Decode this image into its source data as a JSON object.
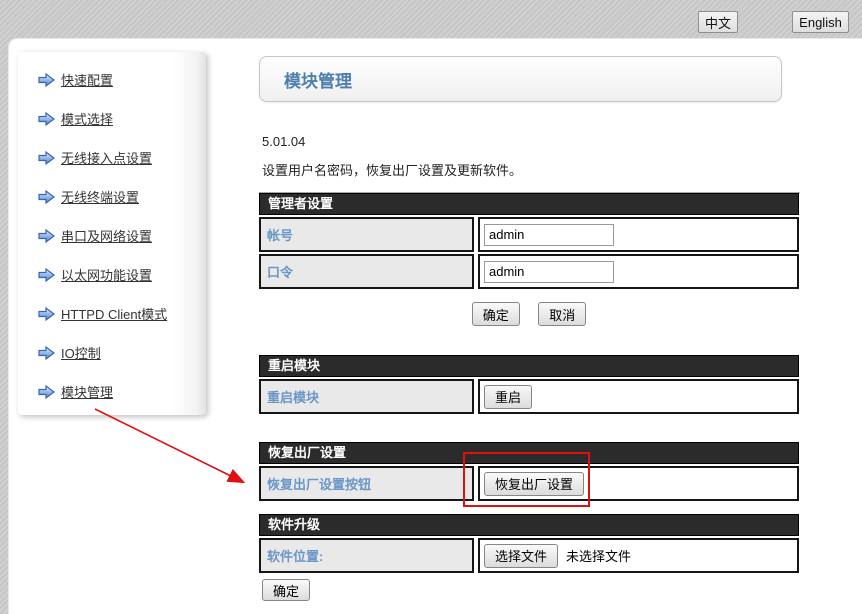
{
  "language_bar": {
    "chinese": "中文",
    "english": "English"
  },
  "sidebar": {
    "items": [
      {
        "label": "快速配置"
      },
      {
        "label": "模式选择"
      },
      {
        "label": "无线接入点设置"
      },
      {
        "label": "无线终端设置"
      },
      {
        "label": "串口及网络设置"
      },
      {
        "label": "以太网功能设置"
      },
      {
        "label": "HTTPD Client模式"
      },
      {
        "label": "IO控制"
      },
      {
        "label": "模块管理"
      }
    ]
  },
  "main": {
    "page_title": "模块管理",
    "version": "5.01.04",
    "description": "设置用户名密码，恢复出厂设置及更新软件。",
    "admin": {
      "header": "管理者设置",
      "account_label": "帐号",
      "account_value": "admin",
      "password_label": "口令",
      "password_value": "admin",
      "ok": "确定",
      "cancel": "取消"
    },
    "restart": {
      "header": "重启模块",
      "label": "重启模块",
      "button": "重启"
    },
    "factory": {
      "header": "恢复出厂设置",
      "label": "恢复出厂设置按钮",
      "button": "恢复出厂设置"
    },
    "upgrade": {
      "header": "软件升级",
      "label": "软件位置:",
      "choose_file": "选择文件",
      "no_file": "未选择文件",
      "ok": "确定"
    }
  },
  "colors": {
    "page_title_blue": "#4d7eae",
    "row_label_blue": "#6a96c8",
    "table_header_bg": "#2b2b2b",
    "sidebar_arrow_blue": "#5b8dd6",
    "annotation_red": "#e01010"
  }
}
